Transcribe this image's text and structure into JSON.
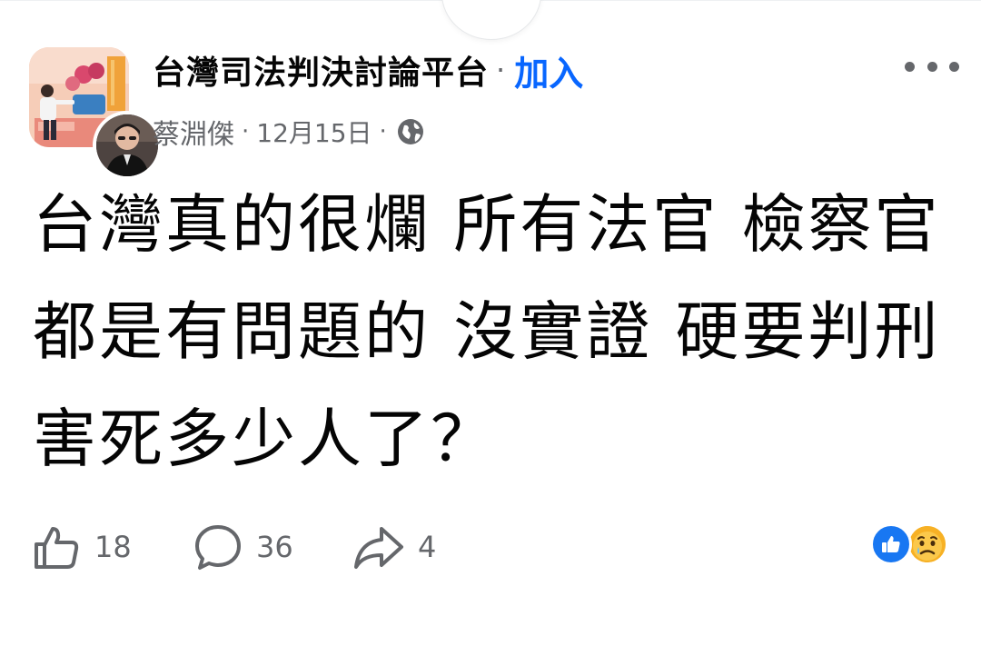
{
  "post": {
    "group_name": "台灣司法判決討論平台",
    "separator": "·",
    "join_label": "加入",
    "author_name": "蔡淵傑",
    "meta_separator": "·",
    "date": "12月15日",
    "audience_icon": "globe-icon",
    "more_icon": "more-options-icon",
    "text": "台灣真的很爛 所有法官 檢察官都是有問題的 沒實證 硬要判刑 害死多少人了？"
  },
  "actions": {
    "like": {
      "icon": "like-icon",
      "count": "18"
    },
    "comment": {
      "icon": "comment-icon",
      "count": "36"
    },
    "share": {
      "icon": "share-icon",
      "count": "4"
    }
  },
  "reactions": [
    "like-reaction-icon",
    "sad-reaction-icon"
  ],
  "colors": {
    "link_blue": "#0866ff",
    "secondary_text": "#65676b",
    "primary_text": "#050505",
    "like_blue": "#1877f2",
    "sad_yellow": "#f7b125"
  }
}
